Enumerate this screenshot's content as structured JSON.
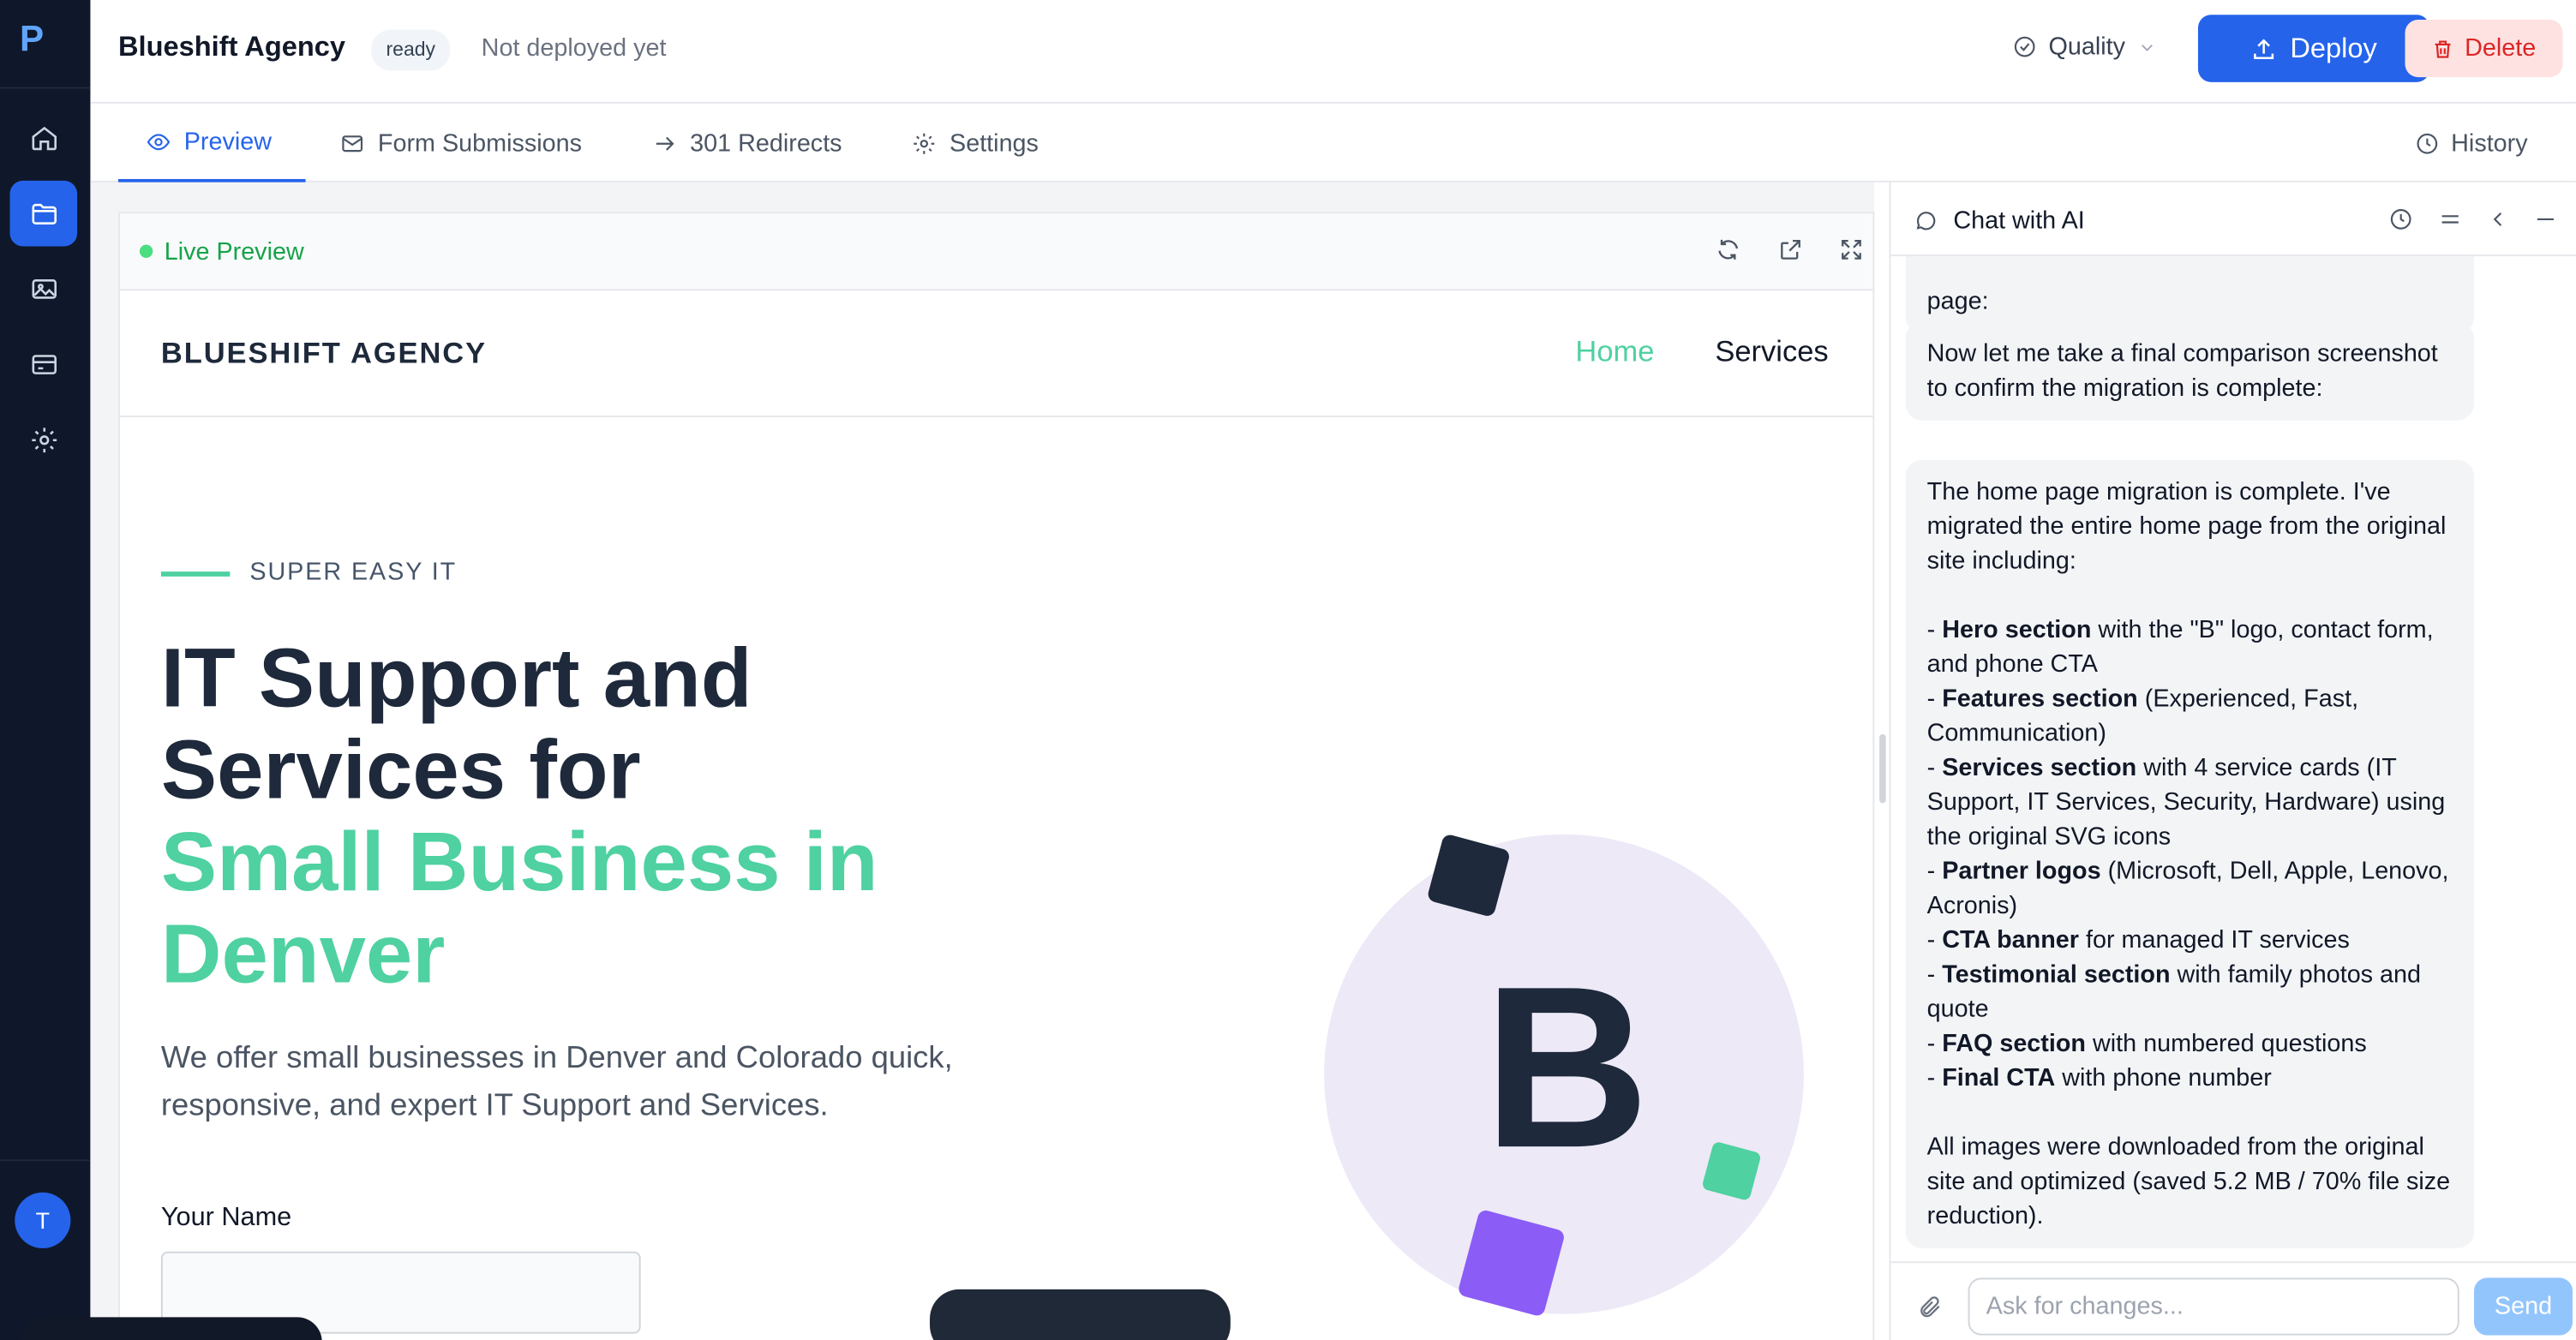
{
  "header": {
    "site_name": "Blueshift Agency",
    "status_badge": "ready",
    "deploy_status": "Not deployed yet",
    "quality_label": "Quality",
    "deploy_label": "Deploy",
    "delete_label": "Delete"
  },
  "tabs": [
    {
      "label": "Preview",
      "icon": "eye-icon",
      "active": true
    },
    {
      "label": "Form Submissions",
      "icon": "mail-icon",
      "active": false
    },
    {
      "label": "301 Redirects",
      "icon": "arrow-right-icon",
      "active": false
    },
    {
      "label": "Settings",
      "icon": "gear-icon",
      "active": false
    }
  ],
  "history_label": "History",
  "sidebar": {
    "items": [
      {
        "icon": "home-icon",
        "active": false
      },
      {
        "icon": "folder-icon",
        "active": true
      },
      {
        "icon": "image-icon",
        "active": false
      },
      {
        "icon": "card-icon",
        "active": false
      },
      {
        "icon": "gear-icon",
        "active": false
      }
    ],
    "avatar_initial": "T"
  },
  "preview": {
    "live_label": "Live Preview",
    "site": {
      "brand": "BLUESHIFT AGENCY",
      "nav": [
        "Home",
        "Services"
      ],
      "eyebrow": "SUPER EASY IT",
      "hero_title_line1": "IT Support and",
      "hero_title_line2": "Services for",
      "hero_title_accent1": "Small Business in",
      "hero_title_accent2": "Denver",
      "hero_subtitle": "We offer small businesses in Denver and Colorado quick, responsive, and expert IT Support and Services.",
      "name_label": "Your Name",
      "logo_letter": "B"
    }
  },
  "chat": {
    "title": "Chat with AI",
    "messages": [
      {
        "text": "page:"
      },
      {
        "text": "Now let me take a final comparison screenshot to confirm the migration is complete:"
      },
      {
        "intro": "The home page migration is complete. I've migrated the entire home page from the original site including:",
        "items": [
          {
            "bold": "Hero section",
            "rest": " with the \"B\" logo, contact form, and phone CTA"
          },
          {
            "bold": "Features section",
            "rest": " (Experienced, Fast, Communication)"
          },
          {
            "bold": "Services section",
            "rest": " with 4 service cards (IT Support, IT Services, Security, Hardware) using the original SVG icons"
          },
          {
            "bold": "Partner logos",
            "rest": " (Microsoft, Dell, Apple, Lenovo, Acronis)"
          },
          {
            "bold": "CTA banner",
            "rest": " for managed IT services"
          },
          {
            "bold": "Testimonial section",
            "rest": " with family photos and quote"
          },
          {
            "bold": "FAQ section",
            "rest": " with numbered questions"
          },
          {
            "bold": "Final CTA",
            "rest": " with phone number"
          }
        ],
        "outro": "All images were downloaded from the original site and optimized (saved 5.2 MB / 70% file size reduction)."
      }
    ],
    "input_placeholder": "Ask for changes...",
    "send_label": "Send"
  },
  "colors": {
    "accent": "#2563eb",
    "brand_green": "#4fd1a1",
    "danger": "#dc2626",
    "rail_bg": "#0f172a"
  }
}
